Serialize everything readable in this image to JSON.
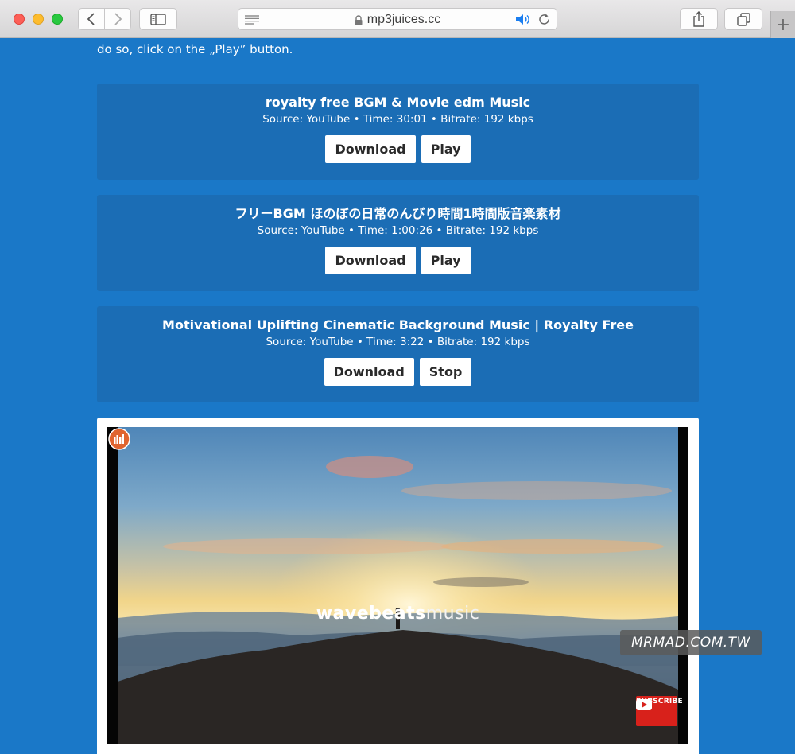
{
  "browser": {
    "url": "mp3juices.cc",
    "icons": {
      "back": "chevron-left-icon",
      "forward": "chevron-right-icon",
      "sidebar": "sidebar-icon",
      "reader": "reader-icon",
      "lock": "lock-icon",
      "audio": "speaker-icon",
      "reload": "reload-icon",
      "share": "share-icon",
      "tabs": "tabs-icon",
      "new_tab": "plus-icon"
    },
    "new_tab_label": "+"
  },
  "page": {
    "intro_partial": "do so, click on the „Play” button.",
    "background_color": "#1a78c8",
    "card_color": "#1b6db5"
  },
  "results": [
    {
      "title": "royalty free BGM & Movie edm Music",
      "meta": "Source: YouTube • Time: 30:01 • Bitrate: 192 kbps",
      "download_label": "Download",
      "action_label": "Play"
    },
    {
      "title": "フリーBGM ほのぼの日常のんびり時間1時間版音楽素材",
      "meta": "Source: YouTube • Time: 1:00:26 • Bitrate: 192 kbps",
      "download_label": "Download",
      "action_label": "Play"
    },
    {
      "title": "Motivational Uplifting Cinematic Background Music | Royalty Free",
      "meta": "Source: YouTube • Time: 3:22 • Bitrate: 192 kbps",
      "download_label": "Download",
      "action_label": "Stop"
    }
  ],
  "player": {
    "brand_bold": "wavebeats",
    "brand_light": "music",
    "subscribe_label": "SUBSCRIBE"
  },
  "watermark": "MRMAD.COM.TW"
}
